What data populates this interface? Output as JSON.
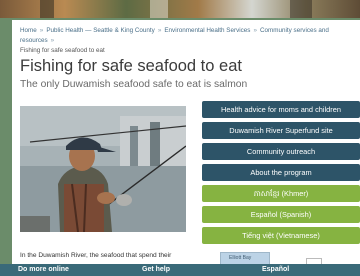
{
  "breadcrumb": {
    "items": [
      "Home",
      "Public Health — Seattle & King County",
      "Environmental Health Services",
      "Community services and resources"
    ],
    "current": "Fishing for safe seafood to eat"
  },
  "page": {
    "title": "Fishing for safe seafood to eat",
    "subtitle": "The only Duwamish seafood safe to eat is salmon"
  },
  "sidebar": {
    "links": [
      {
        "label": "Health advice for moms and children"
      },
      {
        "label": "Duwamish River Superfund site"
      },
      {
        "label": "Community outreach"
      },
      {
        "label": "About the program"
      }
    ],
    "languages": [
      {
        "label": "ភាសាខ្មែរ (Khmer)"
      },
      {
        "label": "Español (Spanish)"
      },
      {
        "label": "Tiếng việt (Vietnamese)"
      }
    ]
  },
  "body": {
    "intro": "In the Duwamish River, the seafood that spend their"
  },
  "map": {
    "label": "Elliott Bay"
  },
  "footer": {
    "links": [
      "Do more online",
      "Get help",
      "Español"
    ]
  },
  "colors": {
    "nav_dark": "#2d5468",
    "nav_green": "#86b341",
    "footer": "#3a6a79",
    "link": "#4a6f88"
  }
}
